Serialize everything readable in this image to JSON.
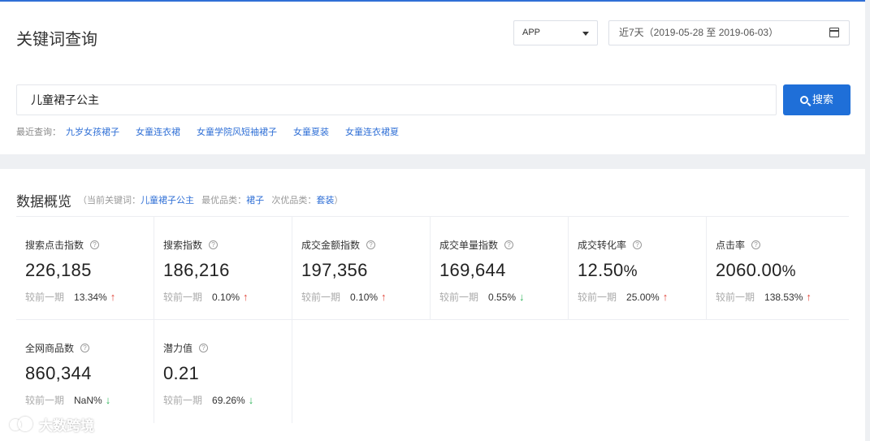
{
  "header": {
    "title": "关键词查询",
    "platform": "APP",
    "date_range": "近7天（2019-05-28 至 2019-06-03）"
  },
  "search": {
    "value": "儿童裙子公主",
    "button_label": "搜索",
    "recent_label": "最近查询：",
    "recent_items": [
      "九岁女孩裙子",
      "女童连衣裙",
      "女童学院风短袖裙子",
      "女童夏装",
      "女童连衣裙夏"
    ]
  },
  "overview": {
    "title": "数据概览",
    "meta_open": "（当前关键词：",
    "keyword": "儿童裙子公主",
    "best_label": "最优品类：",
    "best_category": "裙子",
    "second_label": "次优品类：",
    "second_category": "套装",
    "meta_close": "）",
    "compare_label": "较前一期",
    "metrics": [
      {
        "label": "搜索点击指数",
        "value": "226,185",
        "unit": "",
        "change": "13.34%",
        "trend": "up"
      },
      {
        "label": "搜索指数",
        "value": "186,216",
        "unit": "",
        "change": "0.10%",
        "trend": "up"
      },
      {
        "label": "成交金额指数",
        "value": "197,356",
        "unit": "",
        "change": "0.10%",
        "trend": "up"
      },
      {
        "label": "成交单量指数",
        "value": "169,644",
        "unit": "",
        "change": "0.55%",
        "trend": "down"
      },
      {
        "label": "成交转化率",
        "value": "12.50",
        "unit": "%",
        "change": "25.00%",
        "trend": "up"
      },
      {
        "label": "点击率",
        "value": "2060.00",
        "unit": "%",
        "change": "138.53%",
        "trend": "up"
      },
      {
        "label": "全网商品数",
        "value": "860,344",
        "unit": "",
        "change": "NaN%",
        "trend": "down"
      },
      {
        "label": "潜力值",
        "value": "0.21",
        "unit": "",
        "change": "69.26%",
        "trend": "down"
      }
    ]
  },
  "watermark": {
    "text": "大数跨境"
  },
  "icons": {
    "help": "question-circle-icon",
    "up": "arrow-up-icon",
    "down": "arrow-down-icon",
    "calendar": "calendar-icon",
    "search": "search-icon"
  },
  "colors": {
    "accent": "#1f6fd8",
    "up": "#e0463a",
    "down": "#2fb45a"
  }
}
